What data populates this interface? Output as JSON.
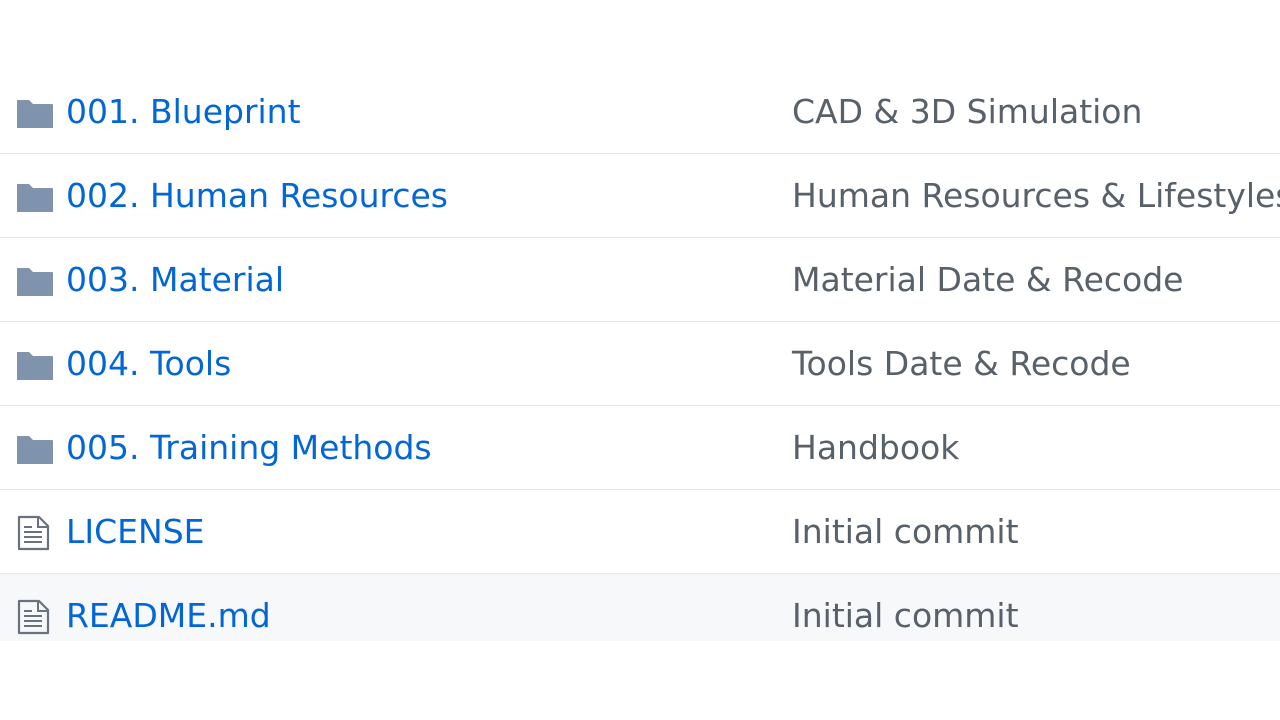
{
  "colors": {
    "link": "#0366d6",
    "message": "#586069",
    "folder_icon": "#79b8ff",
    "file_icon": "#6a737d",
    "divider": "#e1e4e8",
    "highlight_row": "#f6f8fa"
  },
  "files": [
    {
      "type": "folder",
      "icon": "folder-icon",
      "name": "001. Blueprint",
      "message": "CAD & 3D Simulation"
    },
    {
      "type": "folder",
      "icon": "folder-icon",
      "name": "002. Human Resources",
      "message": "Human Resources & Lifestyles"
    },
    {
      "type": "folder",
      "icon": "folder-icon",
      "name": "003. Material",
      "message": "Material Date & Recode"
    },
    {
      "type": "folder",
      "icon": "folder-icon",
      "name": "004. Tools",
      "message": "Tools Date & Recode"
    },
    {
      "type": "folder",
      "icon": "folder-icon",
      "name": "005. Training Methods",
      "message": "Handbook"
    },
    {
      "type": "file",
      "icon": "file-text-icon",
      "name": "LICENSE",
      "message": "Initial commit"
    },
    {
      "type": "file",
      "icon": "file-text-icon",
      "name": "README.md",
      "message": "Initial commit"
    }
  ]
}
